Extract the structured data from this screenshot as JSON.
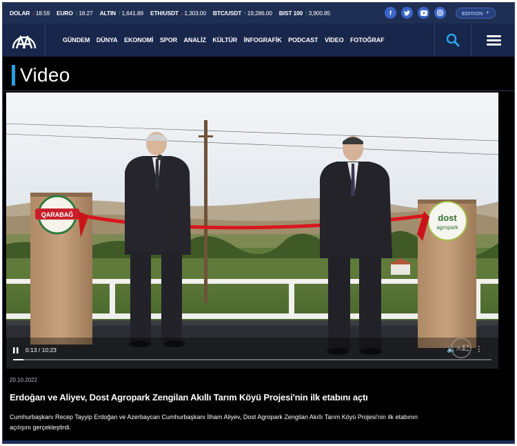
{
  "ticker": [
    {
      "label": "DOLAR",
      "direction": "down",
      "value": "18.59"
    },
    {
      "label": "EURO",
      "direction": "up",
      "value": "18.27"
    },
    {
      "label": "ALTIN",
      "direction": "up",
      "value": "1,641.89"
    },
    {
      "label": "ETH/USDT",
      "direction": "down",
      "value": "1,303.00"
    },
    {
      "label": "BTC/USDT",
      "direction": "up",
      "value": "19,286.00"
    },
    {
      "label": "BIST 100",
      "direction": "up",
      "value": "3,900.85"
    }
  ],
  "social_icons": [
    "facebook-icon",
    "twitter-icon",
    "youtube-icon",
    "instagram-icon"
  ],
  "edition_label": "EDITION",
  "nav": {
    "logo_icon": "aa-logo-icon",
    "items": [
      "GÜNDEM",
      "DÜNYA",
      "EKONOMİ",
      "SPOR",
      "ANALİZ",
      "KÜLTÜR",
      "İNFOGRAFİK",
      "PODCAST",
      "VİDEO",
      "FOTOĞRAF"
    ],
    "search_icon": "search-icon",
    "menu_icon": "hamburger-menu-icon"
  },
  "section_title": "Video",
  "video": {
    "current_time": "0:13",
    "duration": "10:23",
    "time_display": "0:13 / 10:23",
    "progress_fraction": 0.021,
    "watermark": "AA",
    "left_sign": "QARABAĞ",
    "right_sign_line1": "dost",
    "right_sign_line2": "agropark"
  },
  "article": {
    "date": "20.10.2022",
    "headline": "Erdoğan ve Aliyev, Dost Agropark Zengilan Akıllı Tarım Köyü Projesi'nin ilk etabını açtı",
    "summary": "Cumhurbaşkanı Recep Tayyip Erdoğan ve Azerbaycan Cumhurbaşkanı İlham Aliyev, Dost Agropark Zengilan Akıllı Tarım Köyü Projesi'nin ilk etabının açılışını gerçekleştirdi."
  },
  "colors": {
    "topbar": "#1f2f54",
    "navbar": "#17264a",
    "accent": "#27a0e0",
    "down": "#e5393b",
    "up": "#3dc24f",
    "ribbon": "#d9161c"
  }
}
